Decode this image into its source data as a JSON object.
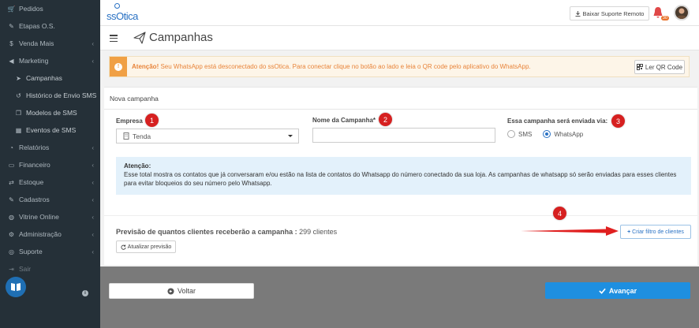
{
  "sidebar": {
    "items": [
      {
        "label": "Pedidos",
        "icon": "cart-icon",
        "chevron": false,
        "sub": false
      },
      {
        "label": "Etapas O.S.",
        "icon": "wrench-icon",
        "chevron": false,
        "sub": false
      },
      {
        "label": "Venda Mais",
        "icon": "dollar-icon",
        "chevron": true,
        "sub": false
      },
      {
        "label": "Marketing",
        "icon": "bullhorn-icon",
        "chevron": true,
        "sub": false
      },
      {
        "label": "Campanhas",
        "icon": "paper-plane-icon",
        "chevron": false,
        "sub": true
      },
      {
        "label": "Histórico de Envio SMS",
        "icon": "history-icon",
        "chevron": false,
        "sub": true
      },
      {
        "label": "Modelos de SMS",
        "icon": "copy-icon",
        "chevron": false,
        "sub": true
      },
      {
        "label": "Eventos de SMS",
        "icon": "calendar-icon",
        "chevron": false,
        "sub": true
      },
      {
        "label": "Relatórios",
        "icon": "pie-chart-icon",
        "chevron": true,
        "sub": false
      },
      {
        "label": "Financeiro",
        "icon": "money-icon",
        "chevron": true,
        "sub": false
      },
      {
        "label": "Estoque",
        "icon": "exchange-icon",
        "chevron": true,
        "sub": false
      },
      {
        "label": "Cadastros",
        "icon": "edit-icon",
        "chevron": true,
        "sub": false
      },
      {
        "label": "Vitrine Online",
        "icon": "globe-icon",
        "chevron": true,
        "sub": false
      },
      {
        "label": "Administração",
        "icon": "cogs-icon",
        "chevron": true,
        "sub": false
      },
      {
        "label": "Suporte",
        "icon": "support-icon",
        "chevron": true,
        "sub": false
      },
      {
        "label": "Sair",
        "icon": "sign-out-icon",
        "chevron": false,
        "sub": false
      }
    ]
  },
  "topbar": {
    "logo": "ssOtica",
    "support_button": "Baixar Suporte Remoto",
    "notification_count": "30"
  },
  "header": {
    "title": "Campanhas"
  },
  "alert": {
    "strong": "Atenção!",
    "message": " Seu WhatsApp está desconectado do ssOtica. Para conectar clique no botão ao lado e leia o QR code pelo aplicativo do WhatsApp.",
    "qr_button": "Ler QR Code"
  },
  "form": {
    "card_title": "Nova campanha",
    "empresa_label": "Empresa",
    "empresa_value": "Tenda",
    "nome_label": "Nome da Campanha*",
    "nome_value": "",
    "via_label": "Essa campanha será enviada via:",
    "via_options": [
      "SMS",
      "WhatsApp"
    ],
    "via_selected": "WhatsApp",
    "markers": [
      "1",
      "2",
      "3",
      "4"
    ],
    "info_title": "Atenção:",
    "info_text": "Esse total mostra os contatos que já conversaram e/ou estão na lista de contatos do Whatsapp do número conectado da sua loja. As campanhas de whatsapp só serão enviadas para esses clientes para evitar bloqueios do seu número pelo Whatsapp.",
    "preview_label": "Previsão de quantos clientes receberão a campanha :",
    "preview_value": " 299 clientes",
    "refresh_button": "Atualizar previsão",
    "filter_button": "Criar filtro de clientes"
  },
  "footer": {
    "back_button": "Voltar",
    "next_button": "Avançar"
  },
  "colors": {
    "sidebar_bg": "#253038",
    "accent": "#1e8fe0",
    "alert_orange": "#f0a045",
    "marker_red": "#d62020",
    "arrow_red": "#e02020"
  }
}
